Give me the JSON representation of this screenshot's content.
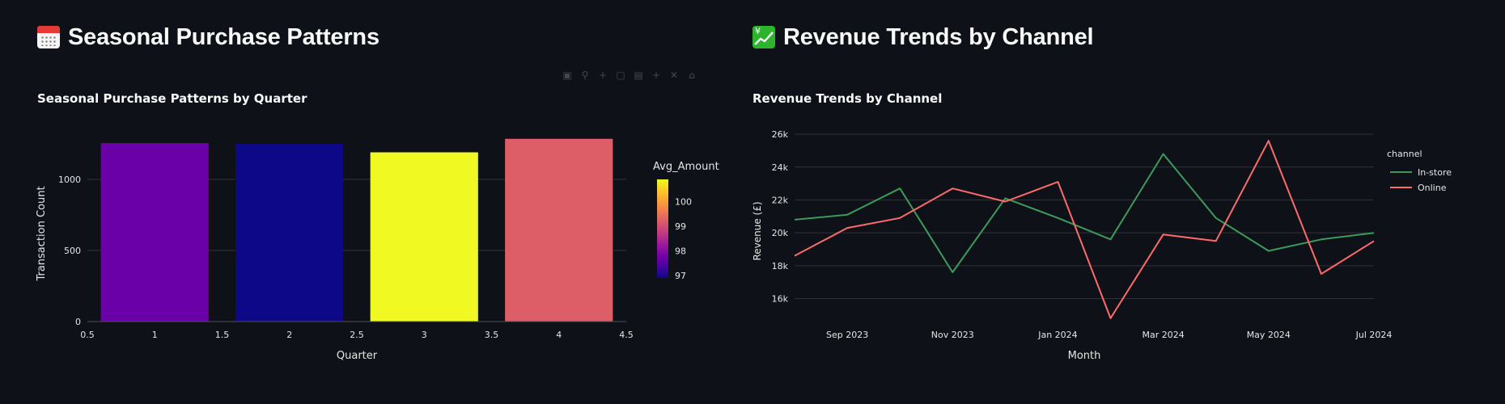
{
  "left": {
    "heading": "Seasonal Purchase Patterns",
    "heading_icon": "calendar-icon",
    "chart_title": "Seasonal Purchase Patterns by Quarter"
  },
  "right": {
    "heading": "Revenue Trends by Channel",
    "heading_icon": "chart-increasing-with-yen-icon",
    "chart_title": "Revenue Trends by Channel"
  },
  "chart_data": [
    {
      "type": "bar",
      "title": "Seasonal Purchase Patterns by Quarter",
      "xlabel": "Quarter",
      "ylabel": "Transaction Count",
      "x": [
        1,
        2,
        3,
        4
      ],
      "values": [
        1255,
        1252,
        1190,
        1285
      ],
      "color_values": [
        97.7,
        96.9,
        100.8,
        99.3
      ],
      "xlim": [
        0.5,
        4.5
      ],
      "ylim": [
        0,
        1352
      ],
      "x_ticks": [
        0.5,
        1,
        1.5,
        2,
        2.5,
        3,
        3.5,
        4,
        4.5
      ],
      "x_tick_labels": [
        "0.5",
        "1",
        "1.5",
        "2",
        "2.5",
        "3",
        "3.5",
        "4",
        "4.5"
      ],
      "y_ticks": [
        0,
        500,
        1000
      ],
      "y_tick_labels": [
        "0",
        "500",
        "1000"
      ],
      "bar_colors": [
        "#6a00a8",
        "#0d0887",
        "#f0f921",
        "#dd5e66"
      ],
      "colorbar": {
        "title": "Avg_Amount",
        "ticks": [
          97,
          98,
          99,
          100
        ],
        "tick_labels": [
          "97",
          "98",
          "99",
          "100"
        ],
        "range": [
          96.9,
          100.9
        ],
        "colorscale": [
          "#0d0887",
          "#46039f",
          "#7201a8",
          "#9c179e",
          "#bd3786",
          "#d8576b",
          "#ed7953",
          "#fb9f3a",
          "#fdca26",
          "#f0f921"
        ]
      },
      "grid": true
    },
    {
      "type": "line",
      "title": "Revenue Trends by Channel",
      "xlabel": "Month",
      "ylabel": "Revenue (£)",
      "x": [
        "2023-08",
        "2023-09",
        "2023-10",
        "2023-11",
        "2023-12",
        "2024-01",
        "2024-02",
        "2024-03",
        "2024-04",
        "2024-05",
        "2024-06",
        "2024-07"
      ],
      "x_tick_labels": [
        "Sep 2023",
        "Nov 2023",
        "Jan 2024",
        "Mar 2024",
        "May 2024",
        "Jul 2024"
      ],
      "x_tick_indices": [
        1,
        3,
        5,
        7,
        9,
        11
      ],
      "y_ticks": [
        16000,
        18000,
        20000,
        22000,
        24000,
        26000
      ],
      "y_tick_labels": [
        "16k",
        "18k",
        "20k",
        "22k",
        "24k",
        "26k"
      ],
      "ylim": [
        14600,
        26300
      ],
      "series": [
        {
          "name": "In-store",
          "color": "#3d9a5b",
          "values": [
            20800,
            21100,
            22700,
            17600,
            22100,
            20900,
            19600,
            24800,
            20900,
            18900,
            19600,
            20000
          ]
        },
        {
          "name": "Online",
          "color": "#ff6b6b",
          "values": [
            18600,
            20300,
            20900,
            22700,
            21900,
            23100,
            14800,
            19900,
            19500,
            25600,
            17500,
            19500
          ]
        }
      ],
      "legend_title": "channel",
      "legend_position": "right",
      "grid": true
    }
  ]
}
